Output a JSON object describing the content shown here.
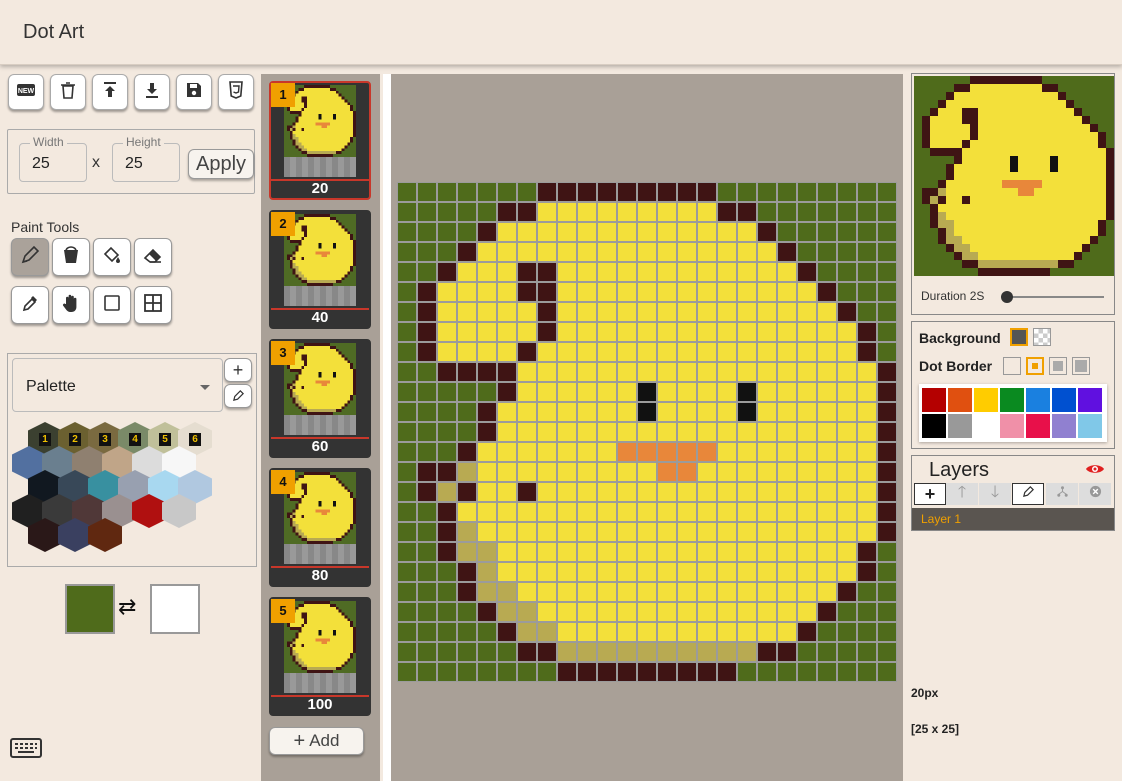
{
  "app": {
    "title": "Dot Art"
  },
  "toolbar": {
    "buttons": [
      {
        "name": "new",
        "icon": "new-icon"
      },
      {
        "name": "delete",
        "icon": "trash-icon"
      },
      {
        "name": "upload",
        "icon": "upload-icon"
      },
      {
        "name": "download",
        "icon": "download-icon"
      },
      {
        "name": "save",
        "icon": "save-icon"
      },
      {
        "name": "export-css",
        "icon": "css3-icon"
      }
    ]
  },
  "size": {
    "width_label": "Width",
    "width_value": "25",
    "x_label": "x",
    "height_label": "Height",
    "height_value": "25",
    "apply_label": "Apply"
  },
  "paint_tools": {
    "label": "Paint Tools",
    "tools": [
      {
        "name": "pencil",
        "icon": "pencil-icon",
        "active": true
      },
      {
        "name": "bucket",
        "icon": "bucket-icon"
      },
      {
        "name": "fill",
        "icon": "paint-fill-icon"
      },
      {
        "name": "eraser",
        "icon": "eraser-icon"
      },
      {
        "name": "eyedropper",
        "icon": "eyedropper-icon"
      },
      {
        "name": "hand",
        "icon": "hand-icon"
      },
      {
        "name": "rectangle",
        "icon": "rectangle-icon"
      },
      {
        "name": "grid",
        "icon": "grid-icon"
      }
    ]
  },
  "palette": {
    "select_value": "Palette",
    "numbered": [
      "1",
      "2",
      "3",
      "4",
      "5",
      "6"
    ],
    "swatches": [
      {
        "c": "#3b4030",
        "n": "1"
      },
      {
        "c": "#6b6030",
        "n": "2"
      },
      {
        "c": "#7a6a40",
        "n": "3"
      },
      {
        "c": "#7a8a68",
        "n": "4"
      },
      {
        "c": "#c0c09a",
        "n": "5"
      },
      {
        "c": "#e5ddd0",
        "n": "6"
      },
      {
        "c": "#5270a0"
      },
      {
        "c": "#6a7f8f"
      },
      {
        "c": "#8f8070"
      },
      {
        "c": "#c0a588"
      },
      {
        "c": "#dcdcdc"
      },
      {
        "c": "#f7f7f7"
      },
      {
        "c": "#111820"
      },
      {
        "c": "#384858"
      },
      {
        "c": "#3890a0"
      },
      {
        "c": "#98a0b0"
      },
      {
        "c": "#a8d8f0"
      },
      {
        "c": "#b0c8e0"
      },
      {
        "c": "#202020"
      },
      {
        "c": "#3a3a3a"
      },
      {
        "c": "#503838"
      },
      {
        "c": "#9a9090"
      },
      {
        "c": "#b01010"
      },
      {
        "c": "#c8c8c8"
      },
      {
        "c": "#2a1818"
      },
      {
        "c": "#3a4060"
      },
      {
        "c": "#602810"
      }
    ]
  },
  "colors": {
    "primary": "#4f6b1b",
    "secondary": "#ffffff"
  },
  "frames": [
    {
      "num": "1",
      "duration": "20"
    },
    {
      "num": "2",
      "duration": "40"
    },
    {
      "num": "3",
      "duration": "60"
    },
    {
      "num": "4",
      "duration": "80"
    },
    {
      "num": "5",
      "duration": "100"
    }
  ],
  "add_label": "Add",
  "grid": {
    "palette": {
      "G": "#4f6b1b",
      "B": "#3f1414",
      "Y": "#f3e03a",
      "O": "#e8873a",
      "K": "#111111",
      "S": "#b8aa52"
    },
    "rows": [
      "GGGGGGGBBBBBBBBBGGGGGGGGG",
      "GGGGGBBYYYYYYYYYBBGGGGGGG",
      "GGGGBYYYYYYYYYYYYYBGGGGGG",
      "GGGBYYYYYYYYYYYYYYYBGGGGG",
      "GGBYYYBBYYYYYYYYYYYYBGGGG",
      "GBYYYYBBYYYYYYYYYYYYYBGGG",
      "GBYYYYYBYYYYYYYYYYYYYYBGG",
      "GBYYYYYBYYYYYYYYYYYYYYYBG",
      "GBYYYYBYYYYYYYYYYYYYYYYBG",
      "GGBBBBYYYYYYYYYYYYYYYYYYB",
      "GGGGGBYYYYYYKYYYYKYYYYYYB",
      "GGGGBYYYYYYYKYYYYKYYYYYYB",
      "GGGGBYYYYYYYYYYYYYYYYYYYB",
      "GGGBYYYYYYYOOOOOYYYYYYYYB",
      "GBBSYYYYYYYYYOOYYYYYYYYYB",
      "GBSBYYBYYYYYYYYYYYYYYYYYB",
      "GGBYYYYYYYYYYYYYYYYYYYYYB",
      "GGBSYYYYYYYYYYYYYYYYYYYYB",
      "GGBSSYYYYYYYYYYYYYYYYYYBG",
      "GGGBSYYYYYYYYYYYYYYYYYYBG",
      "GGGBSSYYYYYYYYYYYYYYYYBGG",
      "GGGGBSSYYYYYYYYYYYYYYBGGG",
      "GGGGGBSSYYYYYYYYYYYYBGGGG",
      "GGGGGGBBSSSSSSSSSSBBGGGGG",
      "GGGGGGGGBBBBBBBBBGGGGGGGG"
    ]
  },
  "preview": {
    "duration_label": "Duration 2S",
    "duration_value": 2
  },
  "settings": {
    "background_label": "Background",
    "dot_border_label": "Dot Border",
    "colors": [
      "#b40000",
      "#e05010",
      "#ffcc00",
      "#0a8a20",
      "#1a80e0",
      "#0050d0",
      "#6010e0",
      "#000000",
      "#999999",
      "#ffffff",
      "#f090a8",
      "#e8104a",
      "#9080d0",
      "#80c8e8"
    ]
  },
  "layers": {
    "title": "Layers",
    "items": [
      {
        "name": "Layer 1"
      }
    ]
  },
  "info": {
    "zoom": "20px",
    "dims": "[25 x 25]"
  }
}
